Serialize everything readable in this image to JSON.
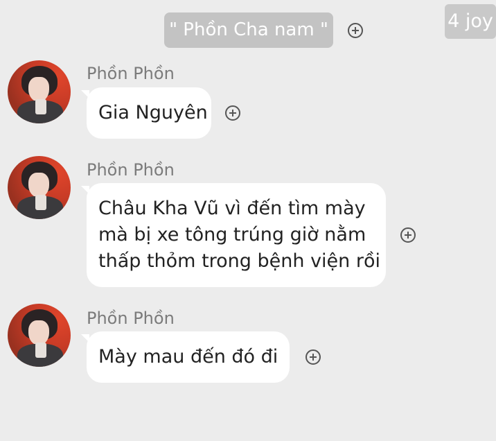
{
  "header": {
    "chat_title": "\" Phồn Cha nam \"",
    "corner_tag": "4 joy"
  },
  "messages": [
    {
      "sender": "Phồn Phồn",
      "lines": [
        "Gia Nguyên"
      ]
    },
    {
      "sender": "Phồn Phồn",
      "lines": [
        "Châu Kha Vũ vì đến tìm mày",
        "mà bị xe tông trúng giờ nằm",
        "thấp thỏm trong bệnh viện rồi"
      ]
    },
    {
      "sender": "Phồn Phồn",
      "lines": [
        "Mày mau đến đó đi"
      ]
    }
  ],
  "icons": {
    "add": "plus-circle-icon",
    "avatar": "user-avatar"
  },
  "colors": {
    "background": "#ececec",
    "badge": "#c3c3c3",
    "bubble": "#ffffff",
    "sender_text": "#7b7b7b",
    "avatar_bg": "#c73b26"
  }
}
